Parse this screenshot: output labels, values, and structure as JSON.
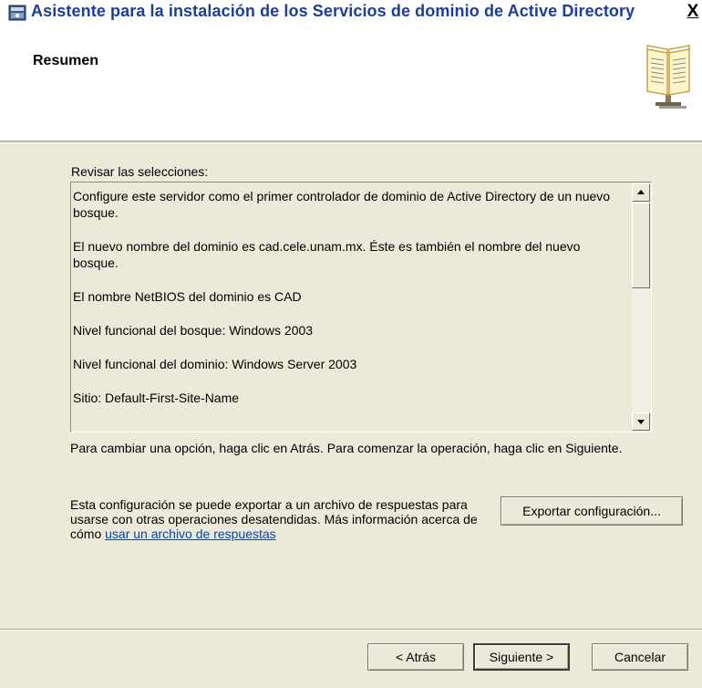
{
  "window": {
    "title": "Asistente para la instalación de los Servicios de dominio de Active Directory",
    "close_label": "X"
  },
  "header": {
    "heading": "Resumen",
    "icon": "book-icon"
  },
  "review": {
    "label": "Revisar las selecciones:",
    "lines": [
      "Configure este servidor como el primer controlador de dominio de Active Directory de un nuevo bosque.",
      "El nuevo nombre del dominio es cad.cele.unam.mx. Éste es también el nombre del nuevo bosque.",
      "El nombre NetBIOS del dominio es CAD",
      "Nivel funcional del bosque: Windows 2003",
      "Nivel funcional del dominio: Windows Server 2003",
      "Sitio: Default-First-Site-Name"
    ]
  },
  "hint": "Para cambiar una opción, haga clic en Atrás. Para comenzar la operación, haga clic en Siguiente.",
  "export": {
    "text": "Esta configuración se puede exportar a un archivo de respuestas para usarse con otras operaciones desatendidas. Más información acerca de cómo ",
    "link": "usar un archivo de respuestas",
    "button": "Exportar configuración..."
  },
  "buttons": {
    "back": "< Atrás",
    "next": "Siguiente >",
    "cancel": "Cancelar"
  },
  "colors": {
    "title": "#1a3f9a",
    "dialog_bg": "#ece9d8",
    "link": "#0645ad"
  }
}
